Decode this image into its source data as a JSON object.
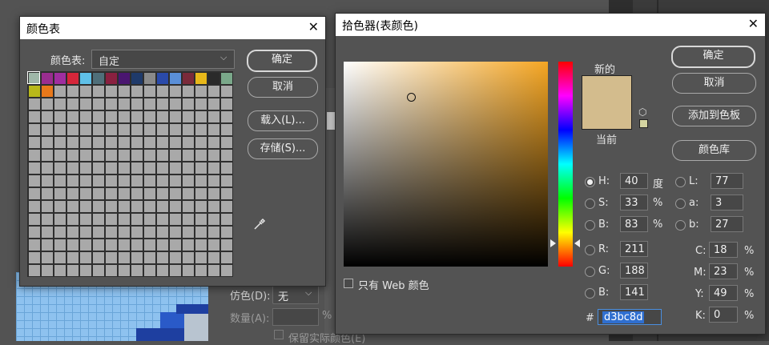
{
  "swatch_dialog": {
    "title": "颜色表",
    "close": "✕",
    "table_label": "颜色表:",
    "table_value": "自定",
    "buttons": {
      "ok": "确定",
      "cancel": "取消",
      "load": "载入(L)...",
      "save": "存储(S)..."
    },
    "swatches": [
      "#9fb7a8",
      "#9a2d8f",
      "#a02ea0",
      "#d6263a",
      "#5fc0e8",
      "#4f6f7a",
      "#8a2040",
      "#4a1670",
      "#1f3a6a",
      "#8a8a8a",
      "#2a4aaa",
      "#5a8fd8",
      "#7a2a3a",
      "#e8b81a",
      "#2a2a2a",
      "#7aa88a",
      "#b8b81a",
      "#e8781a"
    ]
  },
  "picker_dialog": {
    "title": "拾色器(表颜色)",
    "close": "✕",
    "new_label": "新的",
    "current_label": "当前",
    "new_color": "#d3bc8d",
    "current_color": "#d3bc8d",
    "buttons": {
      "ok": "确定",
      "cancel": "取消",
      "add_swatch": "添加到色板",
      "libraries": "颜色库"
    },
    "web_only_label": "只有 Web 颜色",
    "hsb": {
      "h_label": "H:",
      "h": "40",
      "h_unit": "度",
      "s_label": "S:",
      "s": "33",
      "s_unit": "%",
      "b_label": "B:",
      "b": "83",
      "b_unit": "%"
    },
    "rgb": {
      "r_label": "R:",
      "r": "211",
      "g_label": "G:",
      "g": "188",
      "b_label": "B:",
      "b": "141"
    },
    "lab": {
      "l_label": "L:",
      "l": "77",
      "a_label": "a:",
      "a": "3",
      "b_label": "b:",
      "b": "27"
    },
    "cmyk": {
      "c_label": "C:",
      "c": "18",
      "m_label": "M:",
      "m": "23",
      "y_label": "Y:",
      "y": "49",
      "k_label": "K:",
      "k": "0",
      "unit": "%"
    },
    "hex_label": "#",
    "hex": "d3bc8d"
  },
  "background": {
    "dither_label": "仿色(D):",
    "dither_value": "无",
    "amount_label": "数量(A):",
    "amount_unit": "%",
    "preserve_label": "保留实际颜色(E)"
  }
}
